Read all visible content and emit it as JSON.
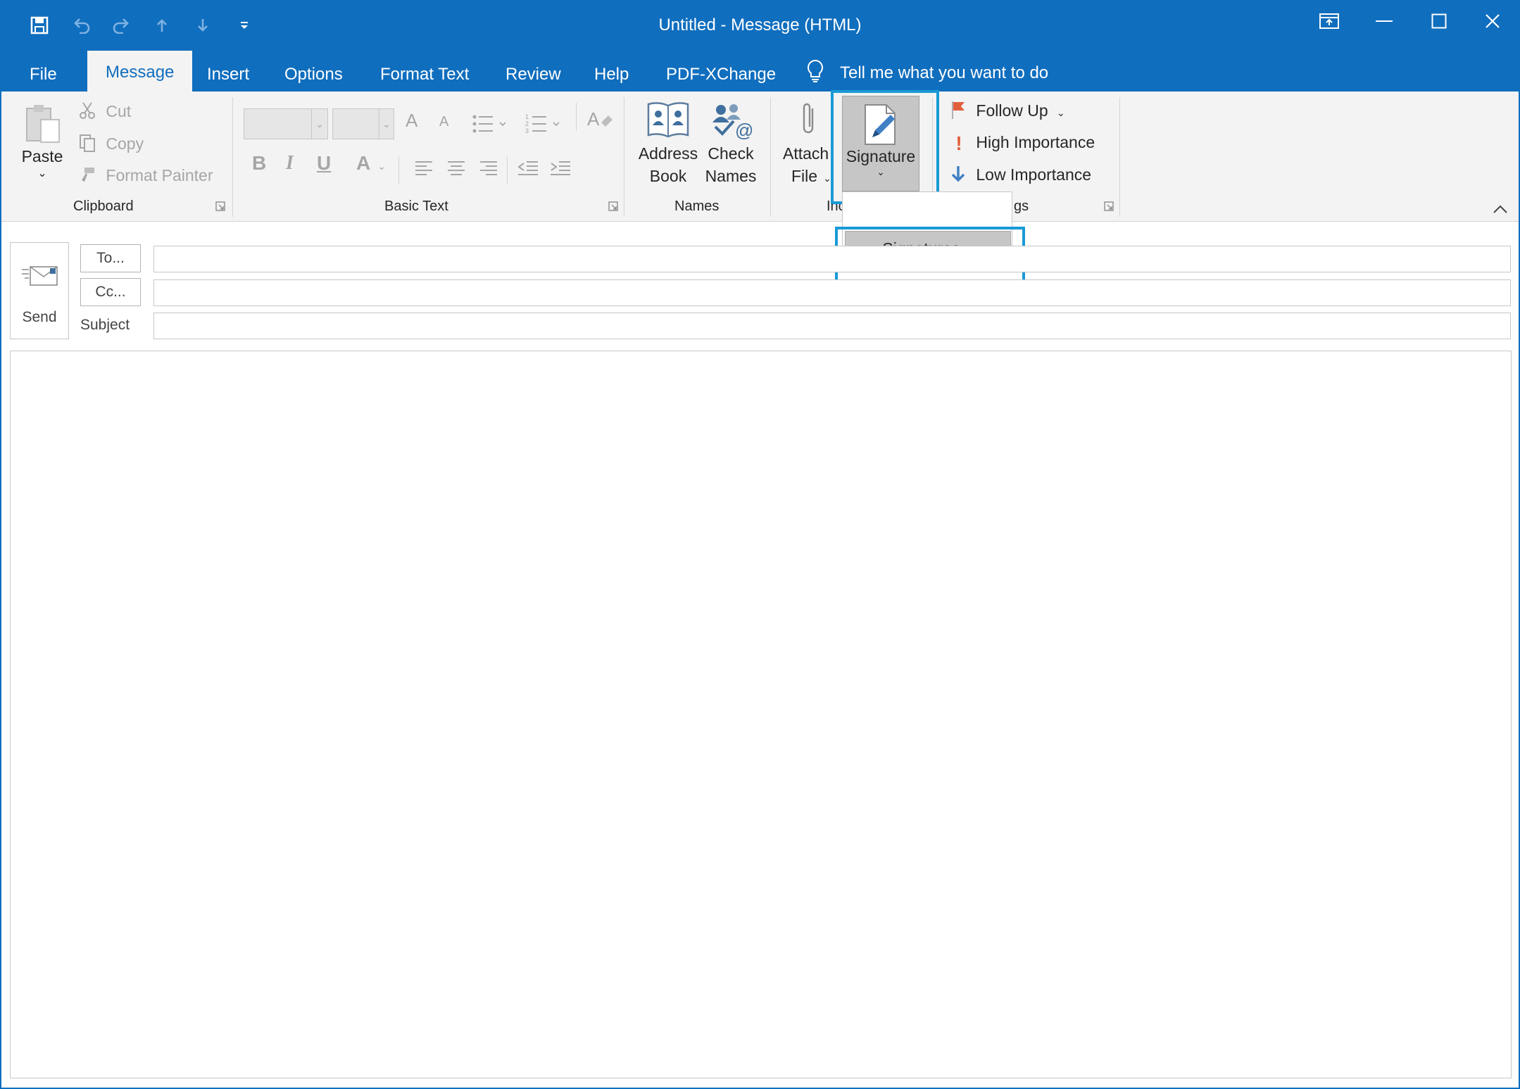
{
  "window": {
    "title": "Untitled  -  Message (HTML)",
    "accent_color": "#106ebe"
  },
  "quick_access": {
    "icons": [
      "save-icon",
      "undo-icon",
      "redo-icon",
      "previous-item-icon",
      "next-item-icon",
      "customize-toolbar-icon"
    ]
  },
  "window_controls": {
    "icons": [
      "ribbon-display-options-icon",
      "minimize-icon",
      "maximize-icon",
      "close-icon"
    ]
  },
  "tabs": [
    {
      "label": "File"
    },
    {
      "label": "Message",
      "active": true
    },
    {
      "label": "Insert"
    },
    {
      "label": "Options"
    },
    {
      "label": "Format Text"
    },
    {
      "label": "Review"
    },
    {
      "label": "Help"
    },
    {
      "label": "PDF-XChange"
    }
  ],
  "tell_me": {
    "label": "Tell me what you want to do"
  },
  "ribbon": {
    "clipboard": {
      "group_label": "Clipboard",
      "paste": "Paste",
      "cut": "Cut",
      "copy": "Copy",
      "format_painter": "Format Painter"
    },
    "basic_text": {
      "group_label": "Basic Text",
      "bold": "B",
      "italic": "I",
      "underline": "U",
      "font_color": "A",
      "grow_font": "A",
      "shrink_font": "A"
    },
    "names": {
      "group_label": "Names",
      "address_book_line1": "Address",
      "address_book_line2": "Book",
      "check_names_line1": "Check",
      "check_names_line2": "Names"
    },
    "include": {
      "group_label_partial": "Inc",
      "attach_file_line1": "Attach",
      "attach_file_line2": "File",
      "signature": "Signature"
    },
    "tags": {
      "group_label_partial": "gs",
      "follow_up": "Follow Up",
      "high_importance": "High Importance",
      "low_importance": "Low Importance"
    }
  },
  "signature_menu": {
    "item": "Signatures..."
  },
  "compose": {
    "send": "Send",
    "to_button": "To...",
    "cc_button": "Cc...",
    "subject_label": "Subject",
    "to_value": "",
    "cc_value": "",
    "subject_value": ""
  }
}
